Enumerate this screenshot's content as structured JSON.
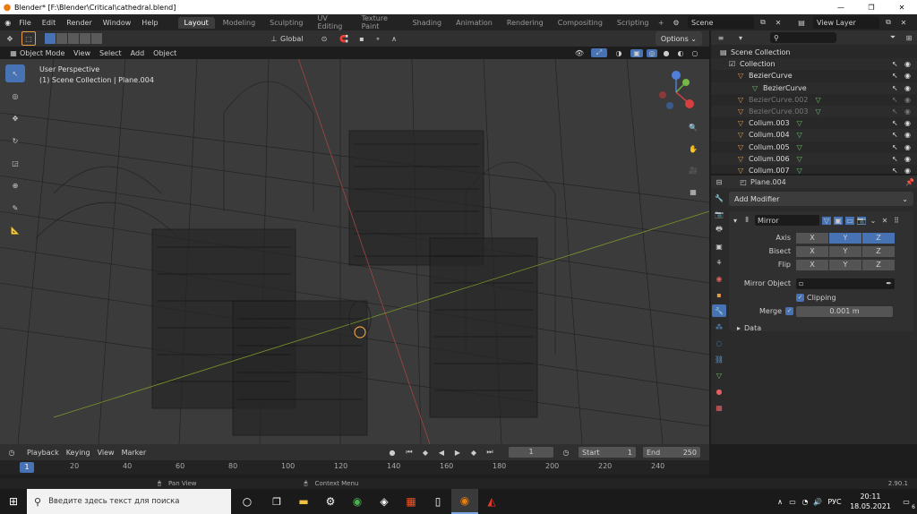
{
  "window": {
    "title": "Blender* [F:\\Blender\\Critical\\cathedral.blend]"
  },
  "menu": [
    "File",
    "Edit",
    "Render",
    "Window",
    "Help"
  ],
  "workspaces": [
    "Layout",
    "Modeling",
    "Sculpting",
    "UV Editing",
    "Texture Paint",
    "Shading",
    "Animation",
    "Rendering",
    "Compositing",
    "Scripting"
  ],
  "scene": {
    "name": "Scene",
    "view_layer": "View Layer"
  },
  "viewport": {
    "mode": "Object Mode",
    "menus": [
      "View",
      "Select",
      "Add",
      "Object"
    ],
    "orientation": "Global",
    "options": "Options",
    "info_line1": "User Perspective",
    "info_line2": "(1) Scene Collection | Plane.004"
  },
  "outliner": {
    "items": [
      {
        "label": "Scene Collection",
        "dim": false
      },
      {
        "label": "Collection",
        "dim": false
      },
      {
        "label": "BezierCurve",
        "dim": false
      },
      {
        "label": "BezierCurve",
        "dim": false
      },
      {
        "label": "BezierCurve.002",
        "dim": true
      },
      {
        "label": "BezierCurve.003",
        "dim": true
      },
      {
        "label": "Collum.003",
        "dim": false
      },
      {
        "label": "Collum.004",
        "dim": false
      },
      {
        "label": "Collum.005",
        "dim": false
      },
      {
        "label": "Collum.006",
        "dim": false
      },
      {
        "label": "Collum.007",
        "dim": false
      }
    ]
  },
  "properties": {
    "object": "Plane.004",
    "add_modifier": "Add Modifier",
    "modifier_name": "Mirror",
    "axis_label": "Axis",
    "bisect_label": "Bisect",
    "flip_label": "Flip",
    "x": "X",
    "y": "Y",
    "z": "Z",
    "mirror_object_label": "Mirror Object",
    "clipping_label": "Clipping",
    "merge_label": "Merge",
    "merge_value": "0.001 m",
    "data_label": "Data"
  },
  "timeline": {
    "playback": "Playback",
    "keying": "Keying",
    "view": "View",
    "marker": "Marker",
    "current_frame": "1",
    "start_label": "Start",
    "start": "1",
    "end_label": "End",
    "end": "250",
    "frame_marker": "1",
    "ticks": [
      "20",
      "40",
      "60",
      "80",
      "100",
      "120",
      "140",
      "160",
      "180",
      "200",
      "220",
      "240"
    ]
  },
  "status": {
    "pan_view": "Pan View",
    "context_menu": "Context Menu",
    "version": "2.90.1"
  },
  "taskbar": {
    "search_placeholder": "Введите здесь текст для поиска",
    "lang": "РУС",
    "time": "20:11",
    "date": "18.05.2021",
    "notif_count": "6"
  },
  "colors": {
    "accent": "#4772b3",
    "header": "#2b2b2b",
    "panel": "#303030",
    "viewport_bg": "#3a3a3a",
    "outliner_green": "#6ec06e",
    "orange": "#e89c4a"
  }
}
